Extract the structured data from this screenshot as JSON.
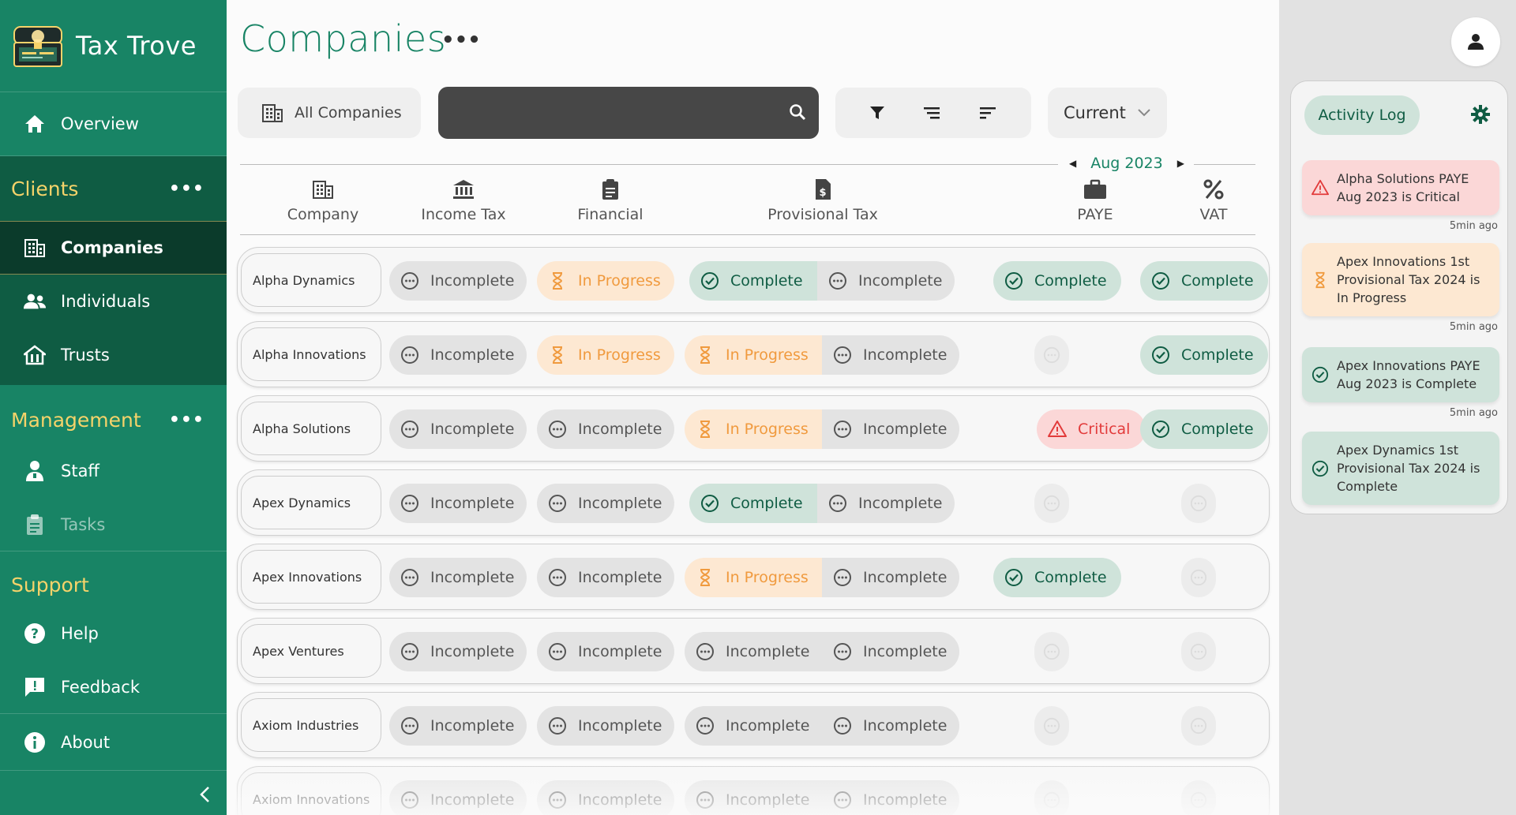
{
  "app": {
    "title": "Tax Trove"
  },
  "sidebar": {
    "overview": "Overview",
    "clients": {
      "heading": "Clients",
      "items": [
        "Companies",
        "Individuals",
        "Trusts"
      ]
    },
    "management": {
      "heading": "Management",
      "items": [
        "Staff",
        "Tasks"
      ]
    },
    "support": {
      "heading": "Support",
      "items": [
        "Help",
        "Feedback",
        "About"
      ]
    },
    "active": "Companies"
  },
  "page": {
    "title": "Companies"
  },
  "toolbar": {
    "scope_label": "All Companies",
    "search": {
      "value": "",
      "placeholder": ""
    },
    "period_selected": "Current"
  },
  "month": {
    "label": "Aug 2023"
  },
  "columns": [
    "Company",
    "Income Tax",
    "Financial",
    "Provisional Tax",
    "PAYE",
    "VAT"
  ],
  "status_labels": {
    "incomplete": "Incomplete",
    "progress": "In Progress",
    "complete": "Complete",
    "critical": "Critical"
  },
  "colors": {
    "brand": "#188465",
    "brand_dark": "#0f5c43",
    "accent_gold": "#f5d36a",
    "incomplete": "#e3e3e3",
    "progress": "#f09a3e",
    "complete": "#cfe3da",
    "critical": "#e23b3b"
  },
  "rows": [
    {
      "name": "Alpha Dynamics",
      "income_tax": "incomplete",
      "financial": "progress",
      "prov1": "complete",
      "prov2": "incomplete",
      "paye": "complete",
      "vat": "complete"
    },
    {
      "name": "Alpha Innovations",
      "income_tax": "incomplete",
      "financial": "progress",
      "prov1": "progress",
      "prov2": "incomplete",
      "paye": "none",
      "vat": "complete"
    },
    {
      "name": "Alpha Solutions",
      "income_tax": "incomplete",
      "financial": "incomplete",
      "prov1": "progress",
      "prov2": "incomplete",
      "paye": "critical",
      "vat": "complete"
    },
    {
      "name": "Apex Dynamics",
      "income_tax": "incomplete",
      "financial": "incomplete",
      "prov1": "complete",
      "prov2": "incomplete",
      "paye": "none",
      "vat": "none"
    },
    {
      "name": "Apex Innovations",
      "income_tax": "incomplete",
      "financial": "incomplete",
      "prov1": "progress",
      "prov2": "incomplete",
      "paye": "complete",
      "vat": "none"
    },
    {
      "name": "Apex Ventures",
      "income_tax": "incomplete",
      "financial": "incomplete",
      "prov1": "incomplete",
      "prov2": "incomplete",
      "paye": "none",
      "vat": "none"
    },
    {
      "name": "Axiom Industries",
      "income_tax": "incomplete",
      "financial": "incomplete",
      "prov1": "incomplete",
      "prov2": "incomplete",
      "paye": "none",
      "vat": "none"
    },
    {
      "name": "Axiom Innovations",
      "income_tax": "incomplete",
      "financial": "incomplete",
      "prov1": "incomplete",
      "prov2": "incomplete",
      "paye": "none",
      "vat": "none"
    }
  ],
  "activity_log": {
    "tab": "Activity Log",
    "items": [
      {
        "status": "critical",
        "text": "Alpha Solutions PAYE Aug 2023 is Critical",
        "time": "5min ago"
      },
      {
        "status": "progress",
        "text": "Apex Innovations 1st Provisional Tax 2024 is In Progress",
        "time": "5min ago"
      },
      {
        "status": "complete",
        "text": "Apex Innovations PAYE Aug 2023 is Complete",
        "time": "5min ago"
      },
      {
        "status": "complete",
        "text": "Apex Dynamics 1st Provisional Tax 2024 is Complete",
        "time": ""
      }
    ]
  }
}
